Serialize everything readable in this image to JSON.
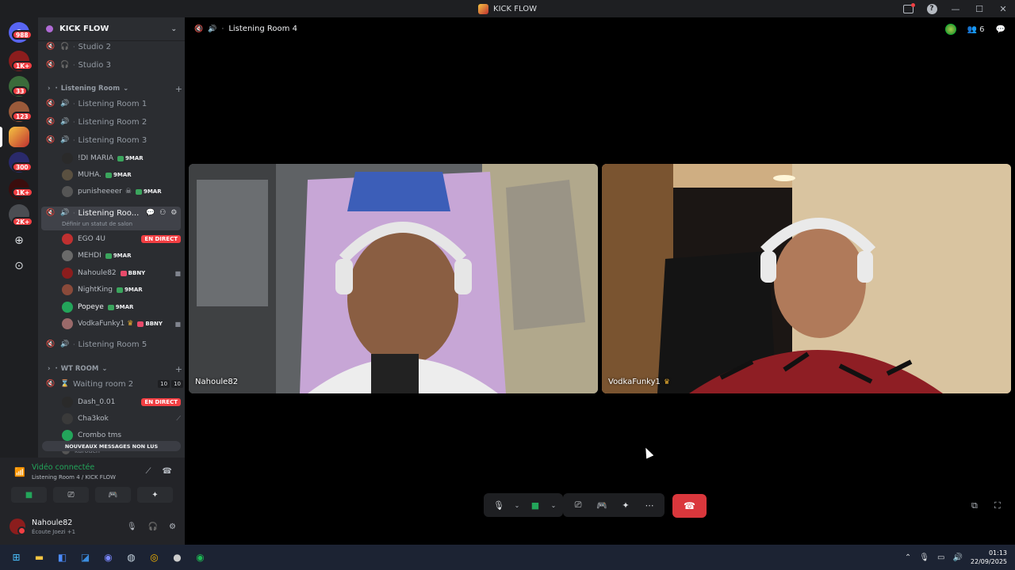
{
  "window": {
    "title": "KICK FLOW"
  },
  "rail": {
    "badges": [
      "988",
      "1K+",
      "33",
      "123",
      "300",
      "1K+",
      "2K+"
    ]
  },
  "server": {
    "name": "KICK FLOW"
  },
  "channels": {
    "studio2": "Studio 2",
    "studio3": "Studio 3",
    "cat_listening": "Listening Room",
    "lr1": "Listening Room 1",
    "lr2": "Listening Room 2",
    "lr3": "Listening Room 3",
    "lr3_users": [
      {
        "name": "!DI MARIA",
        "tag": "9MAR"
      },
      {
        "name": "MUHA.",
        "tag": "9MAR"
      },
      {
        "name": "punisheeeer",
        "tag": "9MAR"
      }
    ],
    "lr4": "Listening Roo...",
    "lr4_status": "Définir un statut de salon",
    "lr4_users": [
      {
        "name": "EGO 4U",
        "badge": "EN DIRECT"
      },
      {
        "name": "MEHDI",
        "tag": "9MAR"
      },
      {
        "name": "Nahoule82",
        "tag": "BBNY"
      },
      {
        "name": "NightKing",
        "tag": "9MAR"
      },
      {
        "name": "Popeye",
        "tag": "9MAR"
      },
      {
        "name": "VodkaFunky1",
        "tag": "BBNY"
      }
    ],
    "lr5": "Listening Room 5",
    "cat_wt": "WT ROOM",
    "waiting": "Waiting room 2",
    "waiting_counts": [
      "10",
      "10"
    ],
    "wt_users": [
      {
        "name": "Dash_0.01",
        "badge": "EN DIRECT"
      },
      {
        "name": "Cha3kok"
      },
      {
        "name": "Crombo tms"
      },
      {
        "name": "karouch"
      }
    ],
    "unread": "NOUVEAUX MESSAGES NON LUS"
  },
  "voice_panel": {
    "status": "Vidéo connectée",
    "path": "Listening Room 4 / KICK FLOW",
    "username": "Nahoule82",
    "activity": "Écoute Joezi +1"
  },
  "stage": {
    "title": "Listening Room 4",
    "participants": "6",
    "tiles": [
      {
        "name": "Nahoule82"
      },
      {
        "name": "VodkaFunky1"
      }
    ]
  },
  "taskbar": {
    "time": "01:13",
    "date": "22/09/2025"
  },
  "colors": {
    "accent_green": "#23a55a",
    "danger_red": "#da373c",
    "live_red": "#f23f43"
  }
}
